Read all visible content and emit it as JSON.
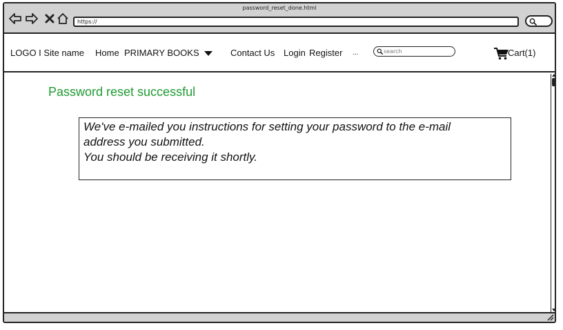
{
  "browser": {
    "page_title": "password_reset_done.html",
    "url": "https://"
  },
  "header": {
    "logo": "LOGO I Site name",
    "nav": {
      "home": "Home",
      "primary_books": "PRIMARY BOOKS",
      "contact": "Contact Us",
      "login": "Login",
      "register": "Register",
      "more": "..."
    },
    "search_placeholder": "search",
    "cart_label": "Cart(1)"
  },
  "main": {
    "heading": "Password reset successful",
    "message_lines": [
      "We've e-mailed you instructions for setting your password to the e-mail",
      "address you submitted.",
      "You should be receiving it shortly."
    ]
  },
  "colors": {
    "heading": "#1f9a32",
    "chrome": "#d2d2d2"
  },
  "icons": [
    "back-arrow-icon",
    "forward-arrow-icon",
    "close-icon",
    "home-icon",
    "search-icon",
    "caret-down-icon",
    "cart-icon",
    "resize-grip-icon"
  ]
}
